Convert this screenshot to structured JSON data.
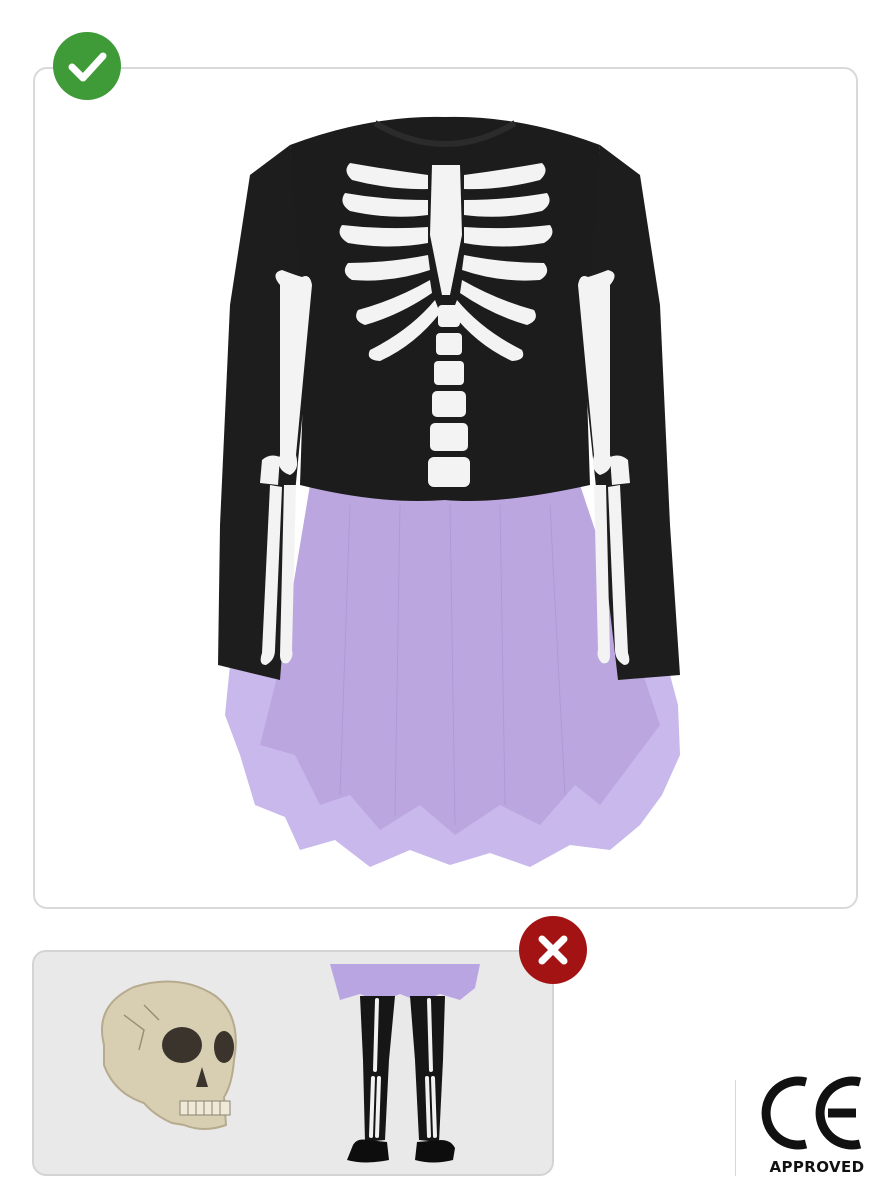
{
  "included_panel": {
    "status_icon": "checkmark-icon",
    "status_color": "#3f9a38",
    "product": "skeleton-costume-dress-black-purple-tutu"
  },
  "excluded_panel": {
    "status_icon": "cross-icon",
    "status_color": "#a31313",
    "items": [
      "skull-prop",
      "skeleton-tights-with-shoes"
    ]
  },
  "certification": {
    "mark_icon": "ce-mark-icon",
    "label": "APPROVED"
  },
  "colors": {
    "dress_black": "#1c1c1c",
    "bone_white": "#f3f3f3",
    "tulle_lilac": "#c8b6e8",
    "skull_bone": "#d9cfb4"
  }
}
